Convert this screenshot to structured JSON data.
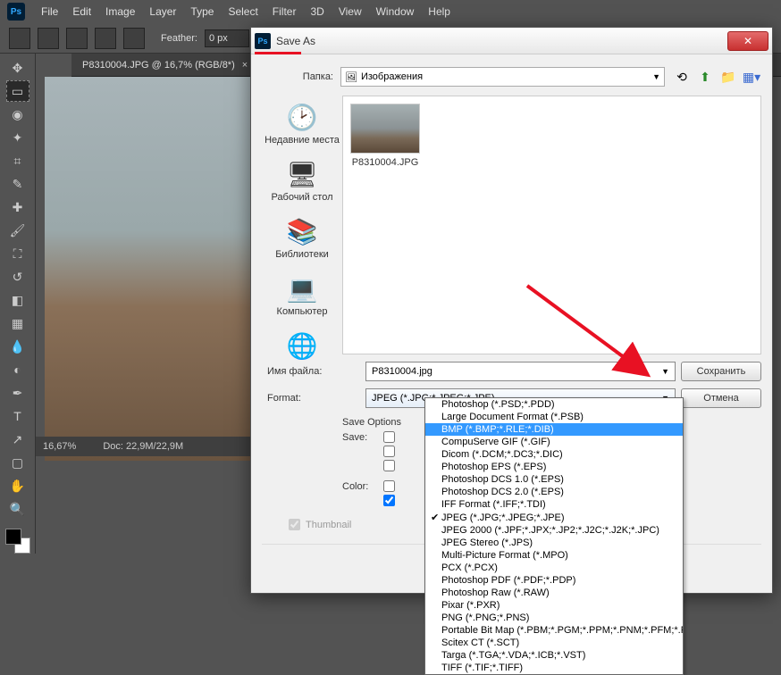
{
  "menubar": [
    "File",
    "Edit",
    "Image",
    "Layer",
    "Type",
    "Select",
    "Filter",
    "3D",
    "View",
    "Window",
    "Help"
  ],
  "options": {
    "feather_label": "Feather:",
    "feather_value": "0 px"
  },
  "tab": {
    "title": "P8310004.JPG @ 16,7% (RGB/8*)"
  },
  "status": {
    "zoom": "16,67%",
    "doc": "Doc: 22,9M/22,9M"
  },
  "dialog": {
    "title": "Save As",
    "folder_label": "Папка:",
    "folder_value": "Изображения",
    "places": {
      "recent": "Недавние места",
      "desktop": "Рабочий стол",
      "libraries": "Библиотеки",
      "computer": "Компьютер"
    },
    "file_name": "P8310004.JPG",
    "filename_label": "Имя файла:",
    "filename_value": "P8310004.jpg",
    "format_label": "Format:",
    "format_value": "JPEG (*.JPG;*.JPEG;*.JPE)",
    "save_btn": "Сохранить",
    "cancel_btn": "Отмена",
    "save_options_hdr": "Save Options",
    "save_label": "Save:",
    "color_label": "Color:",
    "thumb_label": "Thumbnail"
  },
  "formats": [
    "Photoshop (*.PSD;*.PDD)",
    "Large Document Format (*.PSB)",
    "BMP (*.BMP;*.RLE;*.DIB)",
    "CompuServe GIF (*.GIF)",
    "Dicom (*.DCM;*.DC3;*.DIC)",
    "Photoshop EPS (*.EPS)",
    "Photoshop DCS 1.0 (*.EPS)",
    "Photoshop DCS 2.0 (*.EPS)",
    "IFF Format (*.IFF;*.TDI)",
    "JPEG (*.JPG;*.JPEG;*.JPE)",
    "JPEG 2000 (*.JPF;*.JPX;*.JP2;*.J2C;*.J2K;*.JPC)",
    "JPEG Stereo (*.JPS)",
    "Multi-Picture Format (*.MPO)",
    "PCX (*.PCX)",
    "Photoshop PDF (*.PDF;*.PDP)",
    "Photoshop Raw (*.RAW)",
    "Pixar (*.PXR)",
    "PNG (*.PNG;*.PNS)",
    "Portable Bit Map (*.PBM;*.PGM;*.PPM;*.PNM;*.PFM;*.PAM)",
    "Scitex CT (*.SCT)",
    "Targa (*.TGA;*.VDA;*.ICB;*.VST)",
    "TIFF (*.TIF;*.TIFF)"
  ],
  "format_selected_index": 2,
  "format_checked_index": 9
}
